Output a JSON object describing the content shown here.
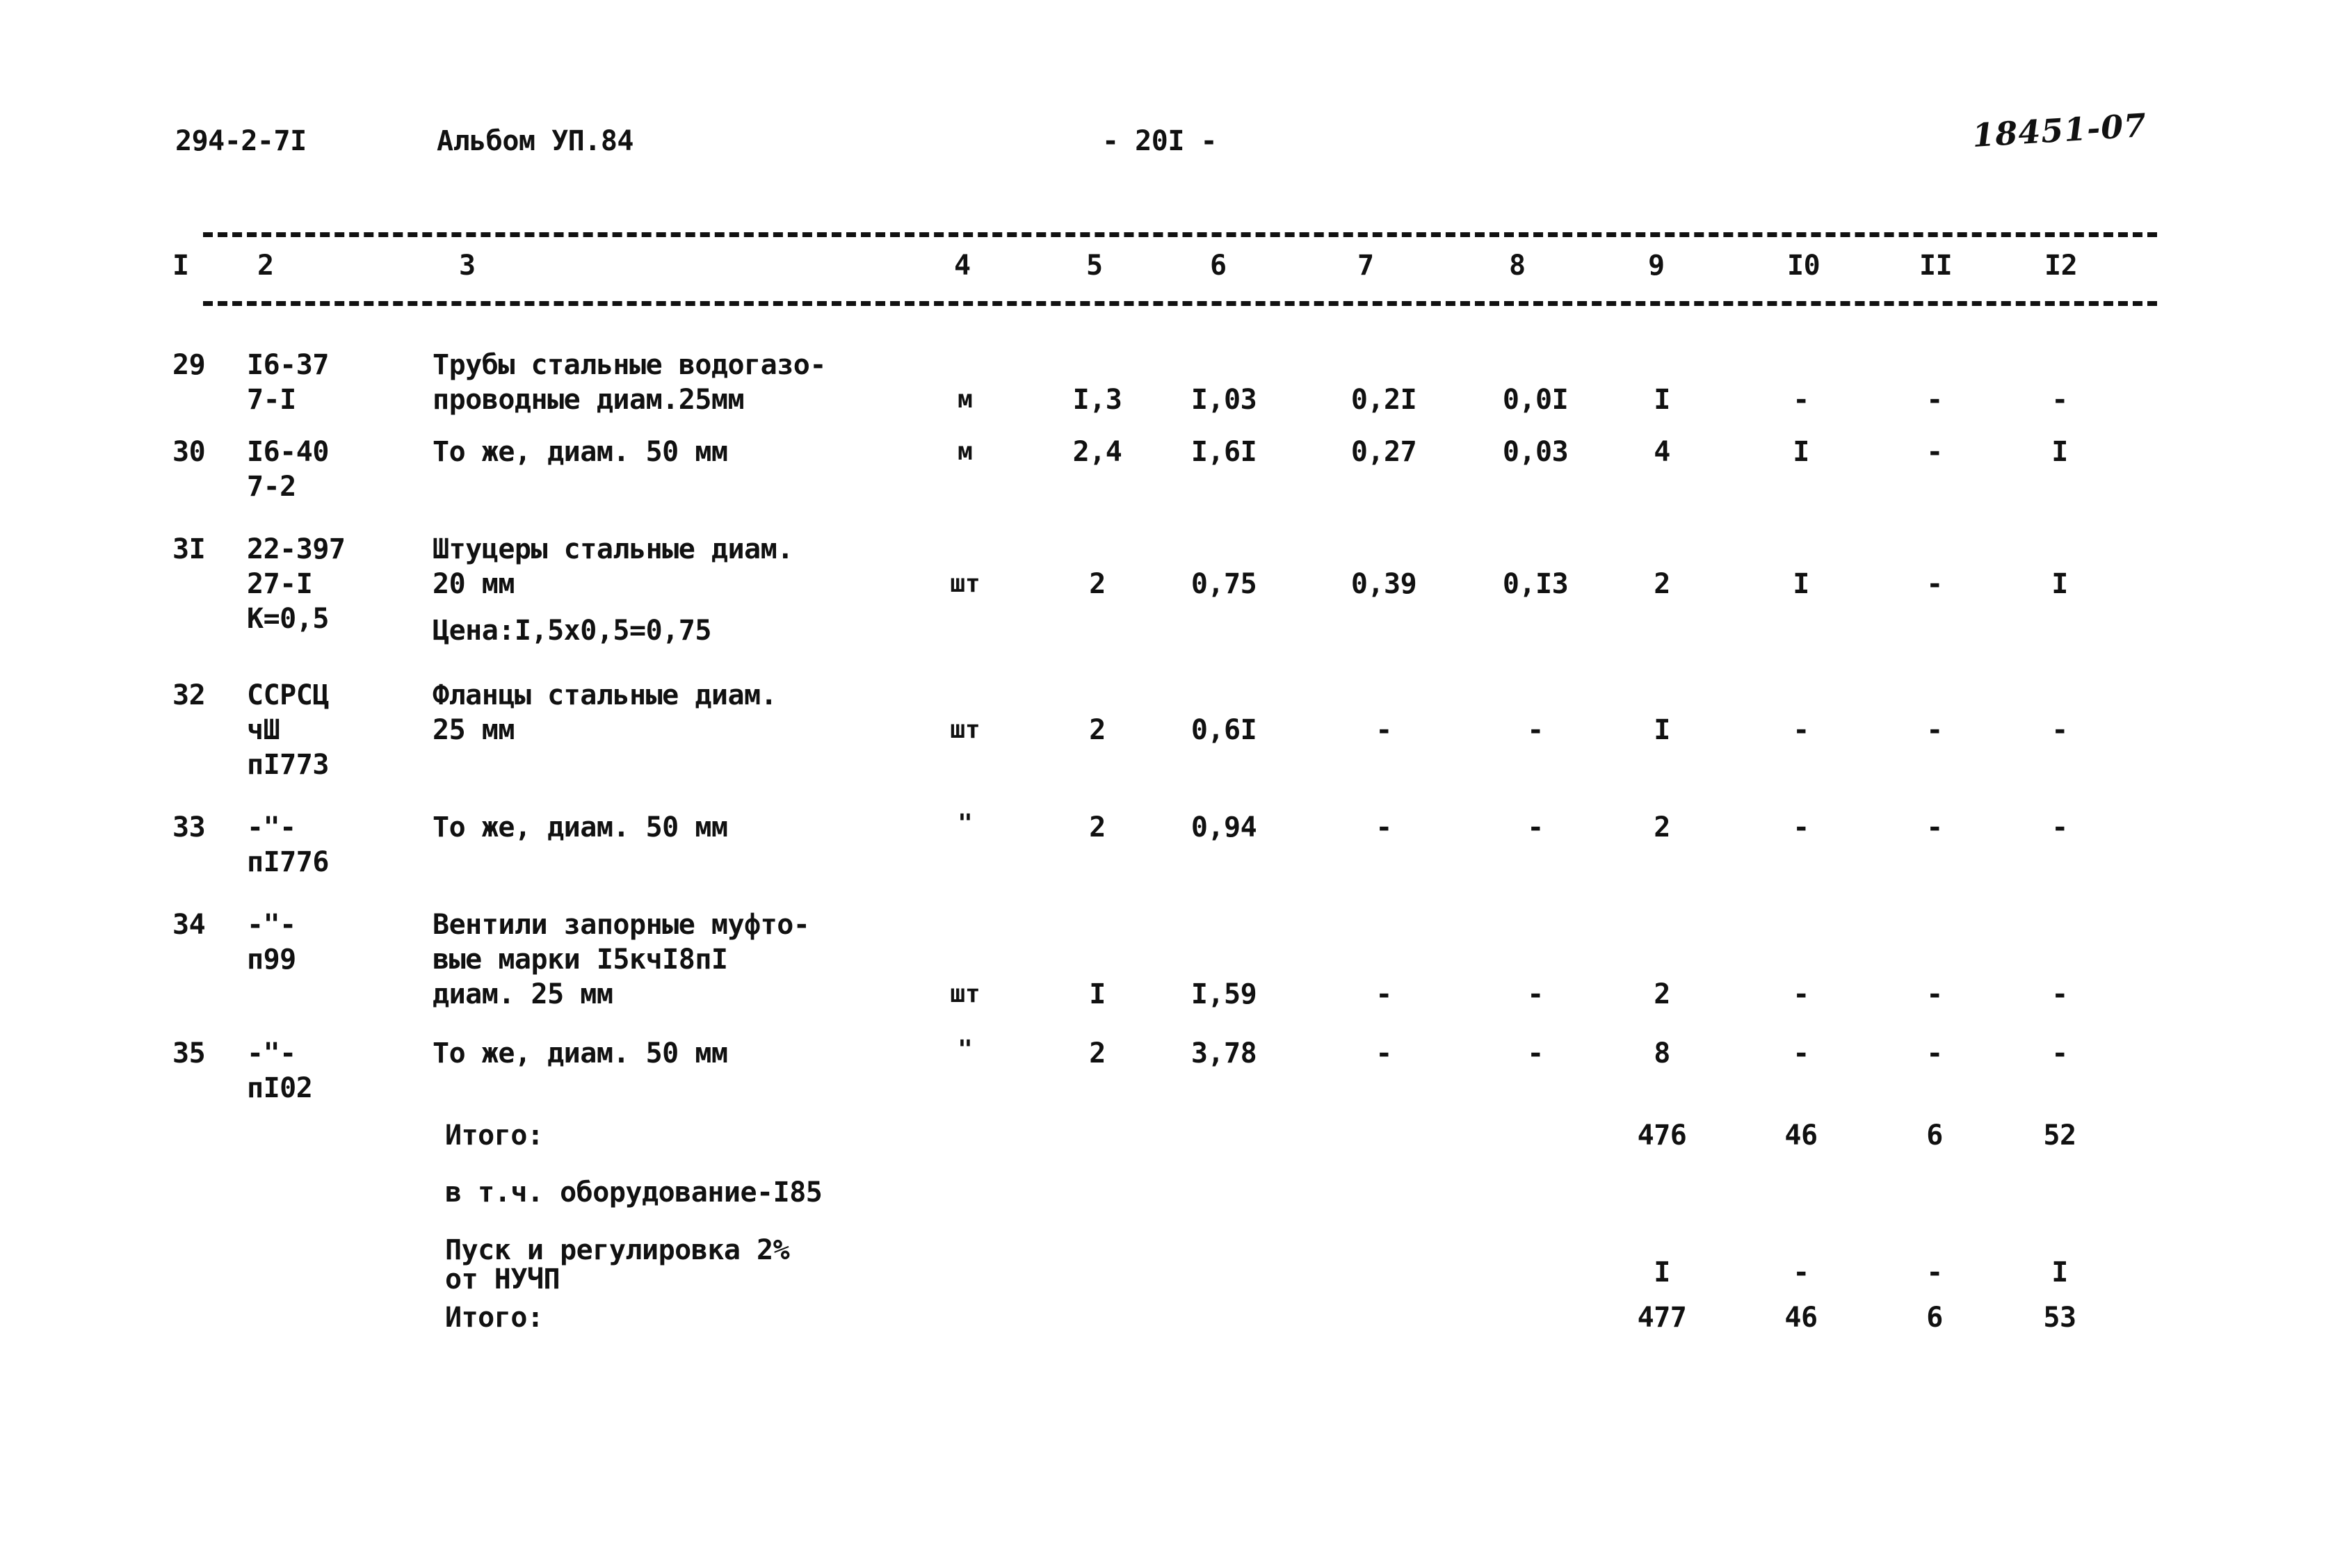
{
  "header": {
    "doc_code": "294-2-7I",
    "album": "Альбом УП.84",
    "page_number": "- 20I -",
    "stamp": "18451-07"
  },
  "table": {
    "column_headers": [
      "I",
      "2",
      "3",
      "4",
      "5",
      "6",
      "7",
      "8",
      "9",
      "I0",
      "II",
      "I2"
    ],
    "rows": [
      {
        "idx": "29",
        "code": "I6-37\n7-I",
        "desc": "Трубы стальные водогазо-\nпроводные диам.25мм",
        "unit": "м",
        "c5": "I,3",
        "c6": "I,03",
        "c7": "0,2I",
        "c8": "0,0I",
        "c9": "I",
        "c10": "-",
        "c11": "-",
        "c12": "-"
      },
      {
        "idx": "30",
        "code": "I6-40\n7-2",
        "desc": "То же, диам. 50 мм",
        "unit": "м",
        "c5": "2,4",
        "c6": "I,6I",
        "c7": "0,27",
        "c8": "0,03",
        "c9": "4",
        "c10": "I",
        "c11": "-",
        "c12": "I"
      },
      {
        "idx": "3I",
        "code": "22-397\n27-I\nК=0,5",
        "desc": "Штуцеры стальные диам.\n20 мм",
        "desc2": "Цена:I,5х0,5=0,75",
        "unit": "шт",
        "c5": "2",
        "c6": "0,75",
        "c7": "0,39",
        "c8": "0,I3",
        "c9": "2",
        "c10": "I",
        "c11": "-",
        "c12": "I"
      },
      {
        "idx": "32",
        "code": "ССРСЦ\nчШ\nпI773",
        "desc": "Фланцы стальные диам.\n25 мм",
        "unit": "шт",
        "c5": "2",
        "c6": "0,6I",
        "c7": "-",
        "c8": "-",
        "c9": "I",
        "c10": "-",
        "c11": "-",
        "c12": "-"
      },
      {
        "idx": "33",
        "code": "-\"-\nпI776",
        "desc": "То же, диам. 50 мм",
        "unit": "\"",
        "c5": "2",
        "c6": "0,94",
        "c7": "-",
        "c8": "-",
        "c9": "2",
        "c10": "-",
        "c11": "-",
        "c12": "-"
      },
      {
        "idx": "34",
        "code": "-\"-\nп99",
        "desc": "Вентили запорные муфто-\nвые марки I5кчI8пI\nдиам. 25 мм",
        "unit": "шт",
        "c5": "I",
        "c6": "I,59",
        "c7": "-",
        "c8": "-",
        "c9": "2",
        "c10": "-",
        "c11": "-",
        "c12": "-"
      },
      {
        "idx": "35",
        "code": "-\"-\nпI02",
        "desc": "То же, диам. 50 мм",
        "unit": "\"",
        "c5": "2",
        "c6": "3,78",
        "c7": "-",
        "c8": "-",
        "c9": "8",
        "c10": "-",
        "c11": "-",
        "c12": "-"
      }
    ],
    "totals": {
      "subtotal_label": "Итого:",
      "subtotal_c9": "476",
      "subtotal_c10": "46",
      "subtotal_c11": "6",
      "subtotal_c12": "52",
      "equipment_note": "в т.ч. оборудование-I85",
      "startup_line1": "Пуск и регулировка 2%",
      "startup_line2": "от НУЧП",
      "startup_c9": "I",
      "startup_c10": "-",
      "startup_c11": "-",
      "startup_c12": "I",
      "total_label": "Итого:",
      "total_c9": "477",
      "total_c10": "46",
      "total_c11": "6",
      "total_c12": "53"
    }
  }
}
